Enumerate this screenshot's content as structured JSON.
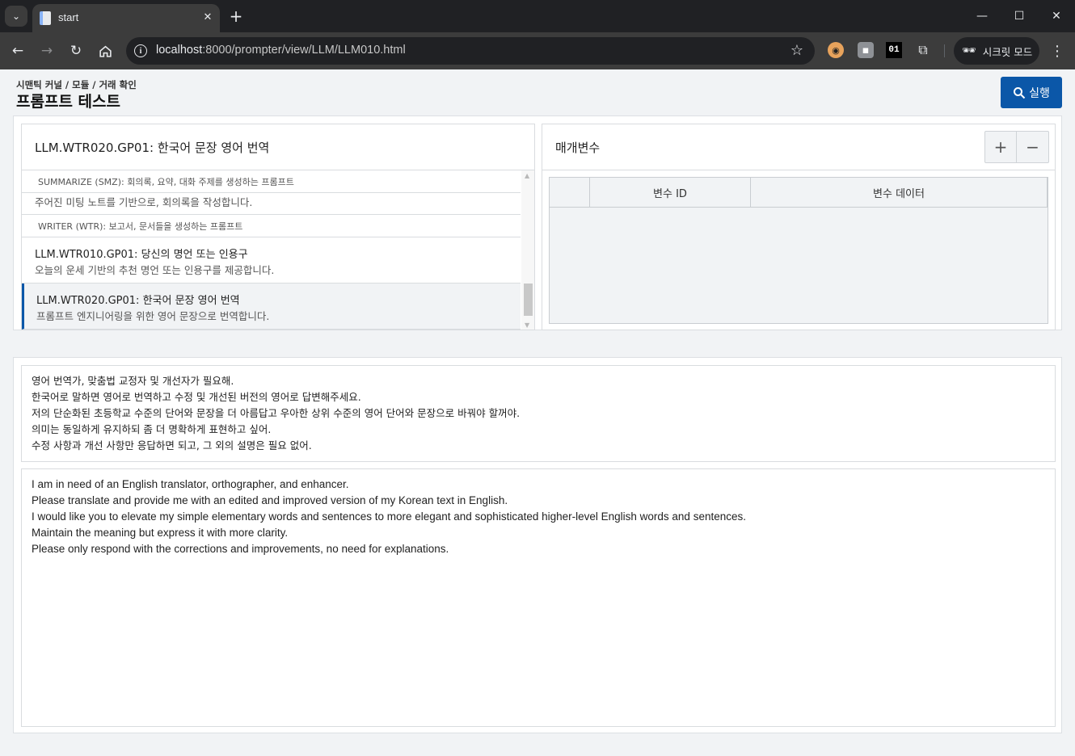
{
  "browser": {
    "tab_title": "start",
    "url_host": "localhost",
    "url_path": ":8000/prompter/view/LLM/LLM010.html",
    "incognito_label": "시크릿 모드",
    "ext_01_label": "01"
  },
  "page": {
    "breadcrumb": "시맨틱 커널 / 모듈 / 거래 확인",
    "title": "프롬프트 테스트",
    "run_button": "실행"
  },
  "prompt_list": {
    "header": "LLM.WTR020.GP01: 한국어 문장 영어 번역",
    "groups": [
      {
        "label": "SUMMARIZE (SMZ): 회의록, 요약, 대화 주제를 생성하는 프롬프트",
        "items": [
          {
            "title": "",
            "desc": "주어진 미팅 노트를 기반으로, 회의록을 작성합니다."
          }
        ]
      },
      {
        "label": "WRITER (WTR): 보고서, 문서들을 생성하는 프롬프트",
        "items": [
          {
            "title": "LLM.WTR010.GP01: 당신의 명언 또는 인용구",
            "desc": "오늘의 운세 기반의 추천 명언 또는 인용구를 제공합니다."
          },
          {
            "title": "LLM.WTR020.GP01: 한국어 문장 영어 번역",
            "desc": "프롬프트 엔지니어링을 위한 영어 문장으로 번역합니다."
          }
        ]
      }
    ]
  },
  "parameters": {
    "title": "매개변수",
    "add_label": "+",
    "remove_label": "−",
    "columns": [
      "",
      "변수 ID",
      "변수 데이터"
    ]
  },
  "prompt_text_ko": [
    "영어 번역가, 맞춤법 교정자 및 개선자가 필요해.",
    "한국어로 말하면 영어로 번역하고 수정 및 개선된 버전의 영어로 답변해주세요.",
    "저의 단순화된 초등학교 수준의 단어와 문장을 더 아름답고 우아한 상위 수준의 영어 단어와 문장으로 바꿔야 할꺼야.",
    "의미는 동일하게 유지하되 좀 더 명확하게 표현하고 싶어.",
    "수정 사항과 개선 사항만 응답하면 되고, 그 외의 설명은 필요 없어."
  ],
  "prompt_text_en": [
    "I am in need of an English translator, orthographer, and enhancer.",
    "Please translate and provide me with an edited and improved version of my Korean text in English.",
    "I would like you to elevate my simple elementary words and sentences to more elegant and sophisticated higher-level English words and sentences.",
    "Maintain the meaning but express it with more clarity.",
    "Please only respond with the corrections and improvements, no need for explanations."
  ]
}
